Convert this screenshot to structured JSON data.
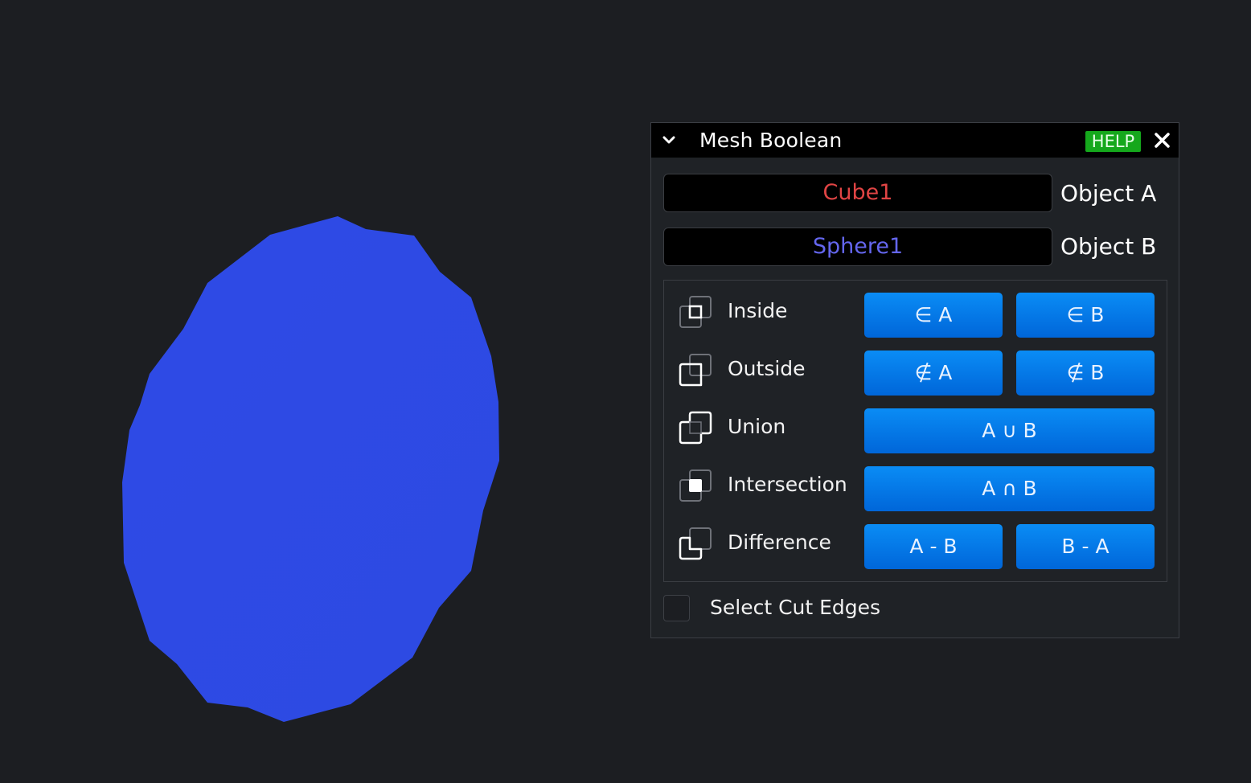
{
  "panel": {
    "title": "Mesh Boolean",
    "help_label": "HELP"
  },
  "objects": {
    "a": {
      "value": "Cube1",
      "label": "Object A",
      "color": "#e04444"
    },
    "b": {
      "value": "Sphere1",
      "label": "Object B",
      "color": "#6466ee"
    }
  },
  "operations": [
    {
      "label": "Inside",
      "icon": "inside-icon",
      "buttons": [
        "∈ A",
        "∈ B"
      ]
    },
    {
      "label": "Outside",
      "icon": "outside-icon",
      "buttons": [
        "∉ A",
        "∉ B"
      ]
    },
    {
      "label": "Union",
      "icon": "union-icon",
      "buttons": [
        "A ∪ B"
      ]
    },
    {
      "label": "Intersection",
      "icon": "intersection-icon",
      "buttons": [
        "A ∩ B"
      ]
    },
    {
      "label": "Difference",
      "icon": "difference-icon",
      "buttons": [
        "A - B",
        "B - A"
      ]
    }
  ],
  "select_cut_edges": {
    "label": "Select Cut Edges",
    "checked": false
  },
  "colors": {
    "button": "#0a7ef0",
    "help": "#15a81c",
    "mesh": "#2e4be6",
    "background": "#1c1e22"
  }
}
